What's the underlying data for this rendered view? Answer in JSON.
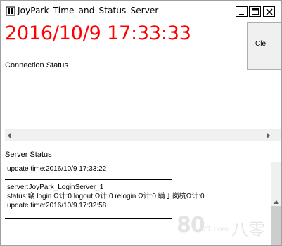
{
  "window": {
    "title": "JoyPark_Time_and_Status_Server",
    "icon": "app-icon",
    "controls": [
      "minimize-icon",
      "maximize-icon",
      "close-icon"
    ]
  },
  "clock": {
    "text": "2016/10/9 17:33:33",
    "color": "#ff0000"
  },
  "clear_button": {
    "label": "Cle"
  },
  "connection_status": {
    "label": "Connection Status"
  },
  "server_status": {
    "label": "Server Status",
    "lines": [
      "update time:2016/10/9 17:33:22",
      "server:JoyPark_LoginServer_1",
      "status:竊    login Ω计:0  logout Ω计:0  relogin Ω计:0   瞒丁岗杭Ω计:0",
      "update time:2016/10/9 17:32:58"
    ]
  },
  "watermark": {
    "number": "80",
    "domain": "xz7.com",
    "chinese": "八零"
  }
}
